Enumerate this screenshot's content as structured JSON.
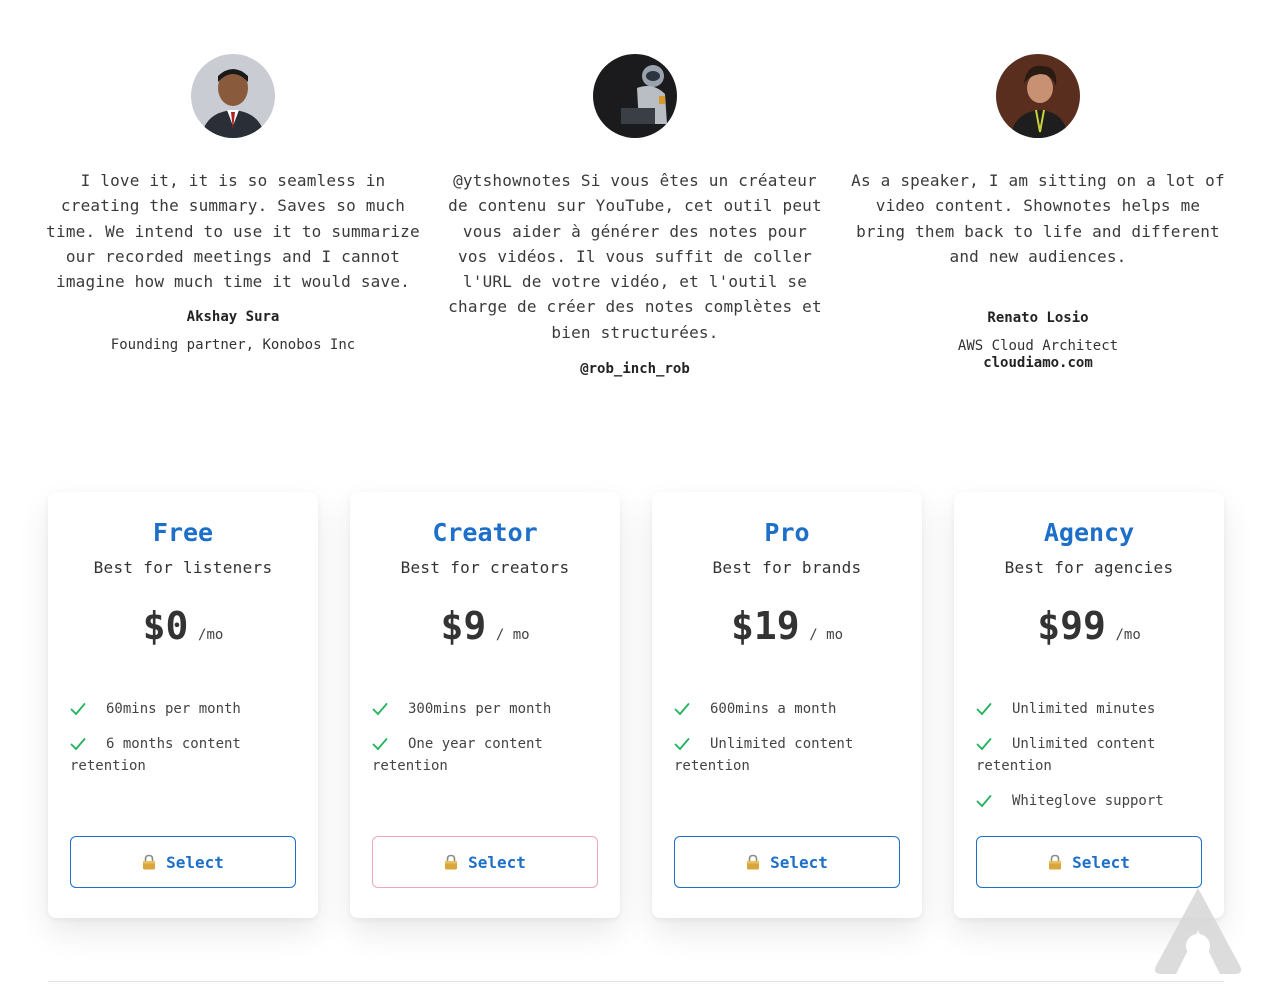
{
  "testimonials": [
    {
      "quote": "I love it, it is so seamless in creating the summary. Saves so much time. We intend to use it to summarize our recorded meetings and I cannot imagine how much time it would save.",
      "name": "Akshay Sura",
      "role": "Founding partner, Konobos Inc"
    },
    {
      "quote": "@ytshownotes Si vous êtes un créateur de contenu sur YouTube, cet outil peut vous aider à générer des notes pour vos vidéos. Il vous suffit de coller l'URL de votre vidéo, et l'outil se charge de créer des notes complètes et bien structurées.",
      "handle": "@rob_inch_rob"
    },
    {
      "quote": "As a speaker, I am sitting on a lot of video content. Shownotes helps me bring them back to life and different and new audiences.",
      "name": "Renato Losio",
      "role": "AWS Cloud Architect",
      "site": "cloudiamo.com"
    }
  ],
  "plans": [
    {
      "name": "Free",
      "subtitle": "Best for listeners",
      "price": "$0",
      "period": "/mo",
      "features": [
        "60mins per month",
        "6 months content retention"
      ],
      "button": "Select"
    },
    {
      "name": "Creator",
      "subtitle": "Best for creators",
      "price": "$9",
      "period": "/ mo",
      "features": [
        "300mins per month",
        "One year content retention"
      ],
      "button": "Select"
    },
    {
      "name": "Pro",
      "subtitle": "Best for brands",
      "price": "$19",
      "period": "/ mo",
      "features": [
        "600mins a month",
        "Unlimited content retention"
      ],
      "button": "Select"
    },
    {
      "name": "Agency",
      "subtitle": "Best for agencies",
      "price": "$99",
      "period": "/mo",
      "features": [
        "Unlimited minutes",
        "Unlimited content retention",
        "Whiteglove support"
      ],
      "button": "Select"
    }
  ],
  "colors": {
    "accent": "#1d6fc9",
    "check": "#22b35e",
    "creator_button_border": "#f0a6b8",
    "text": "#333333"
  },
  "icons": {
    "feature_check": "check-icon",
    "button_lock": "lock-icon",
    "watermark": "app-logo-icon"
  }
}
